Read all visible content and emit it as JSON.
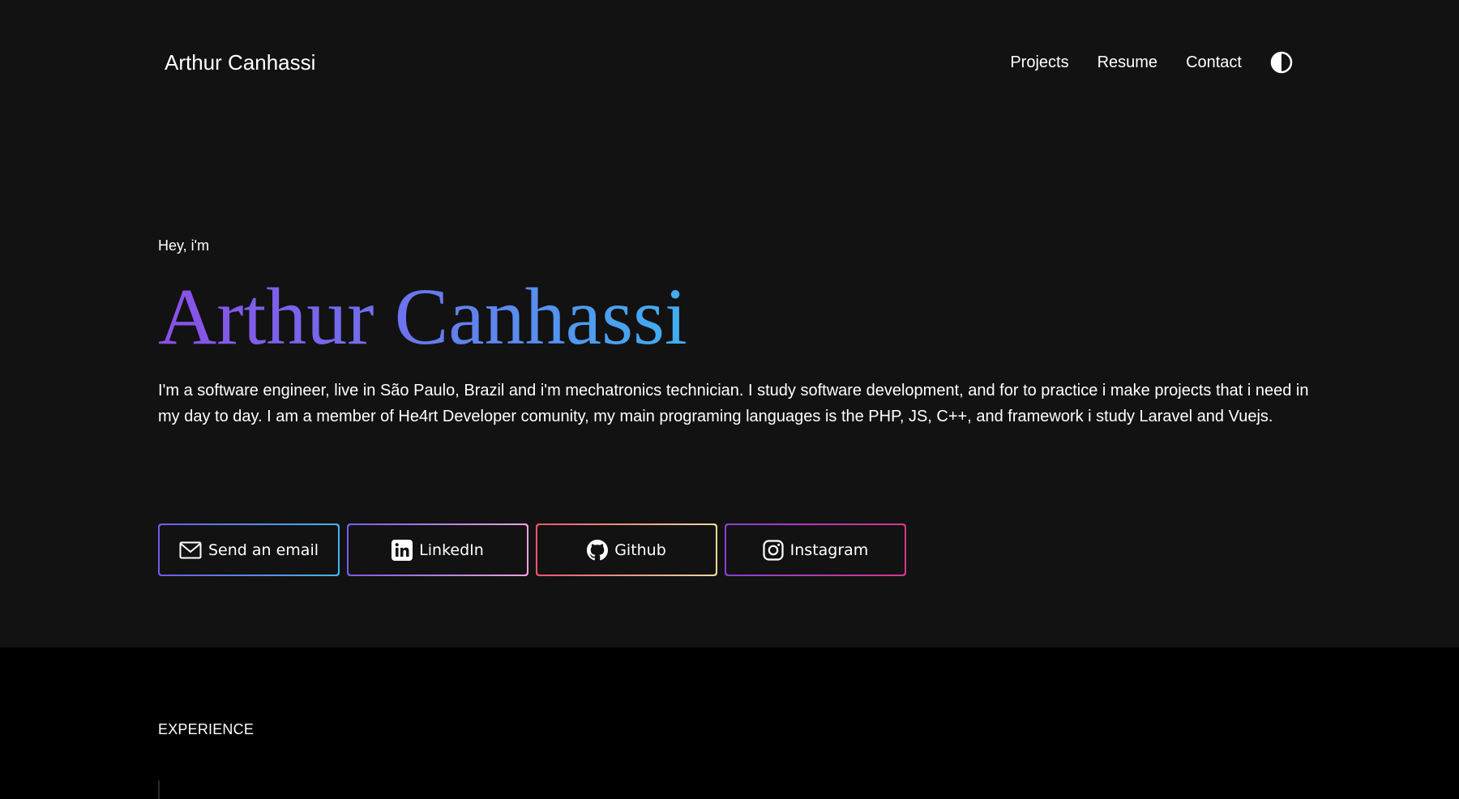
{
  "header": {
    "brand": "Arthur Canhassi",
    "nav": [
      {
        "label": "Projects"
      },
      {
        "label": "Resume"
      },
      {
        "label": "Contact"
      }
    ],
    "theme_toggle_icon": "contrast-icon"
  },
  "hero": {
    "greeting": "Hey, i'm",
    "name": "Arthur Canhassi",
    "name_gradient": [
      "#8b4fe6",
      "#3fb0f0"
    ],
    "bio": "I'm a software engineer, live in São Paulo, Brazil and i'm mechatronics technician. I study software development, and for to practice i make projects that i need in my day to day. I am a member of He4rt Developer comunity, my main programing languages is the PHP, JS, C++, and framework i study Laravel and Vuejs."
  },
  "socials": [
    {
      "label": "Send an email",
      "icon": "mail-icon",
      "colors": [
        "#6f5ae8",
        "#43b6f2"
      ]
    },
    {
      "label": "LinkedIn",
      "icon": "linkedin-icon",
      "colors": [
        "#7a5ae8",
        "#f0a3e0"
      ]
    },
    {
      "label": "Github",
      "icon": "github-icon",
      "colors": [
        "#f0556e",
        "#f7d89a"
      ]
    },
    {
      "label": "Instagram",
      "icon": "instagram-icon",
      "colors": [
        "#8a3fd8",
        "#d9358f"
      ]
    }
  ],
  "experience": {
    "title": "EXPERIENCE"
  },
  "colors": {
    "background": "#121212",
    "section_background": "#000000",
    "text": "#ffffff"
  }
}
